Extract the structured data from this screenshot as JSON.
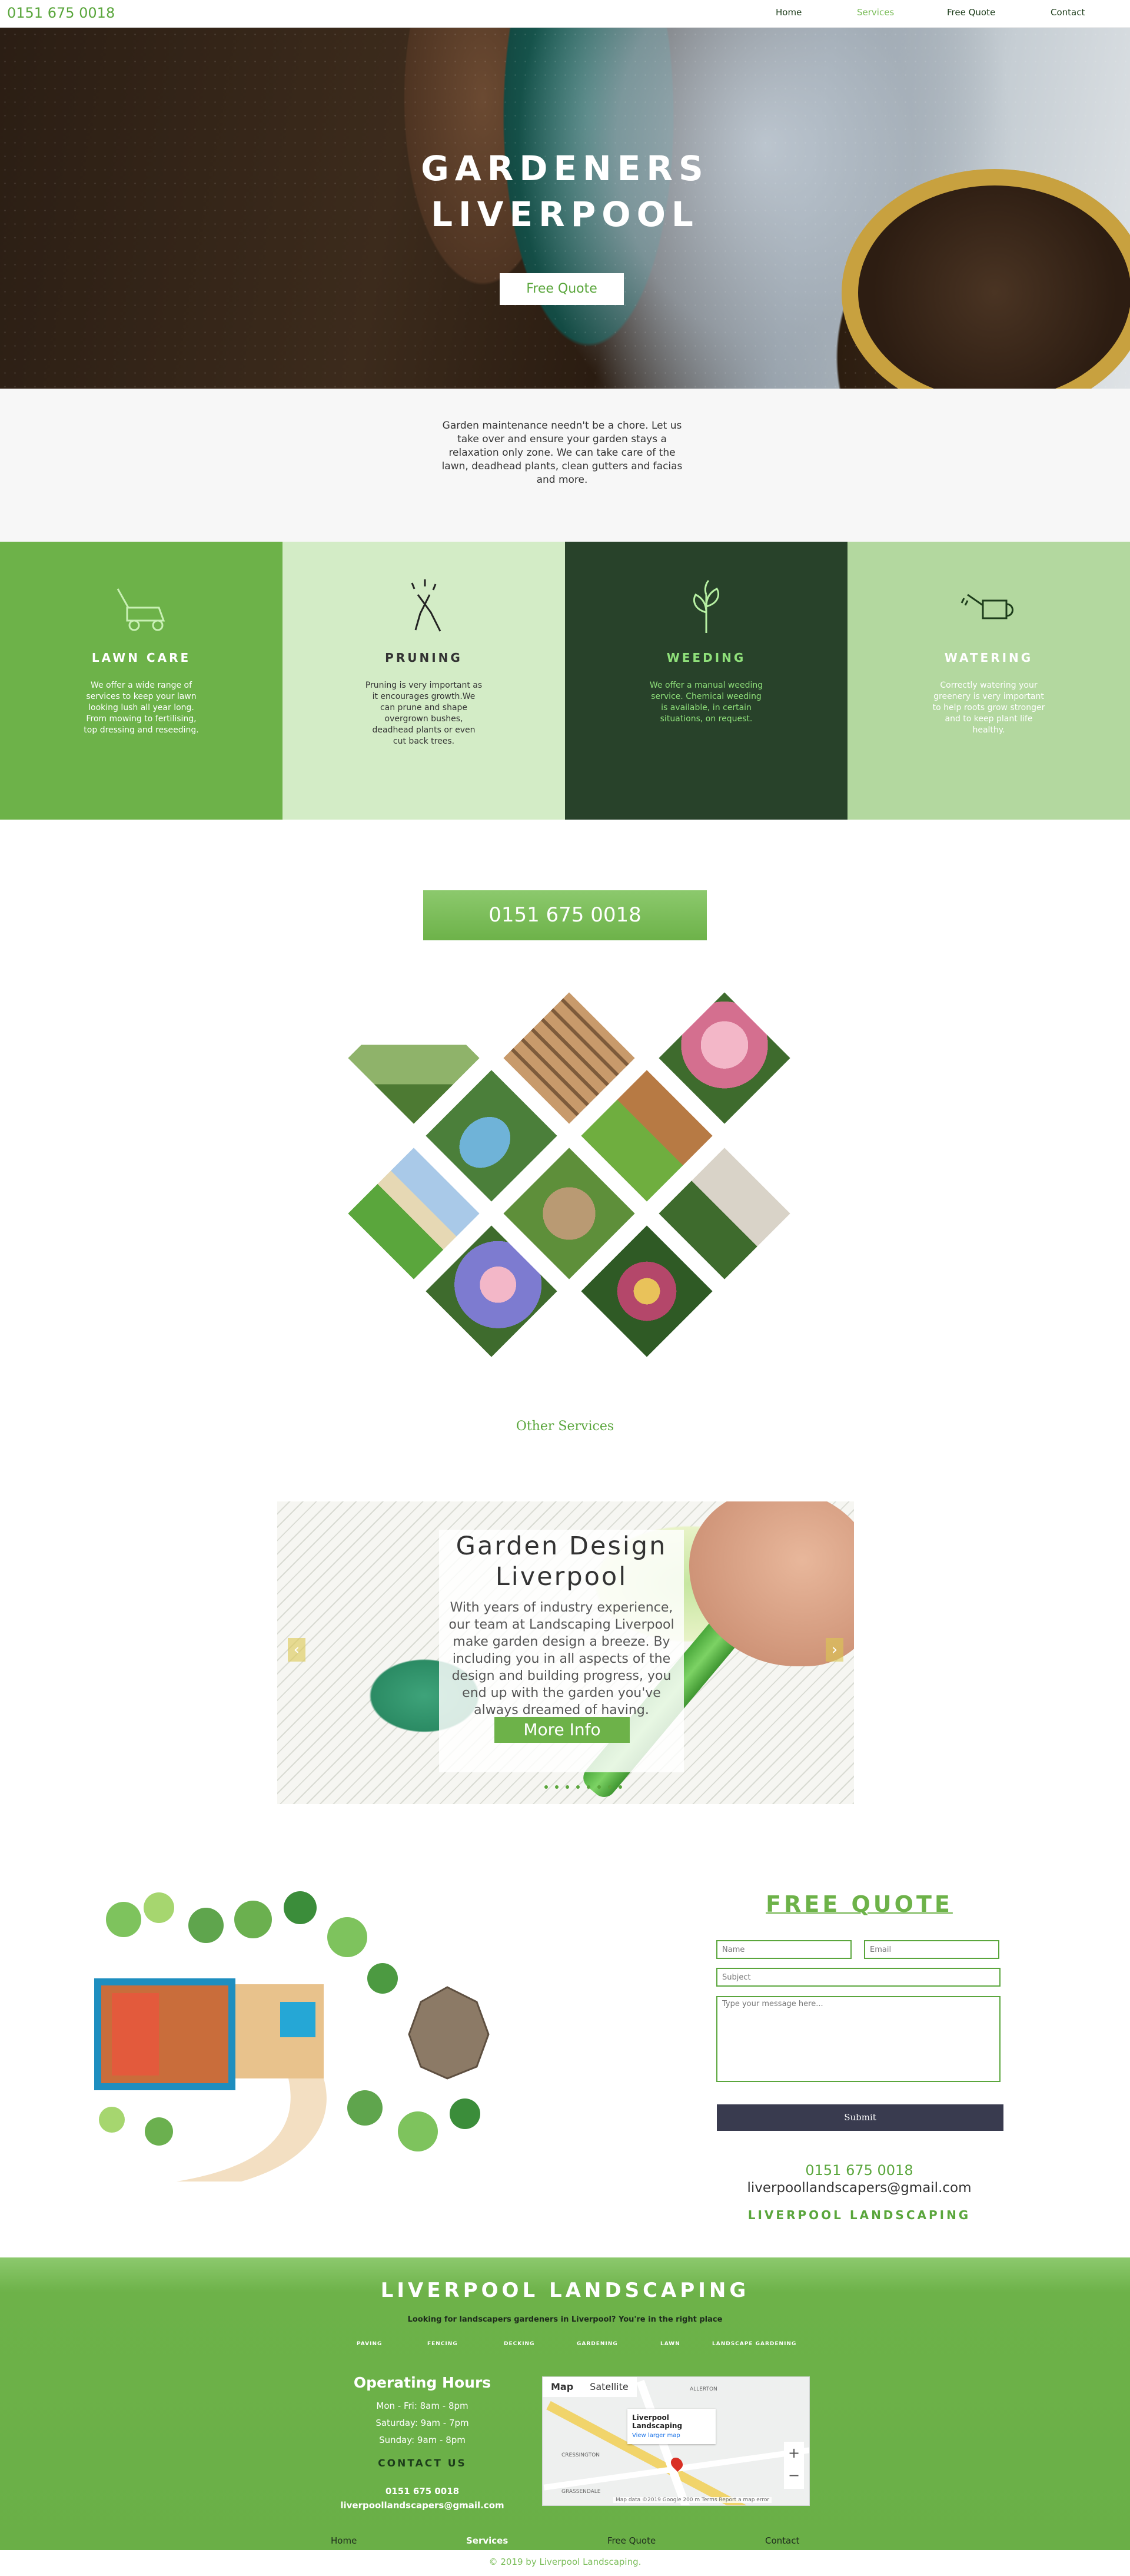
{
  "topnav": {
    "phone": "0151 675 0018",
    "items": [
      {
        "label": "Home"
      },
      {
        "label": "Services"
      },
      {
        "label": "Free Quote"
      },
      {
        "label": "Contact"
      }
    ],
    "active": "Services"
  },
  "hero": {
    "title_line1": "GARDENERS",
    "title_line2": "LIVERPOOL",
    "cta": "Free Quote"
  },
  "intro": {
    "text": "Garden maintenance needn't be a chore. Let us take over and ensure your garden stays a relaxation only zone. We can take care of the lawn, deadhead plants, clean gutters and facias and more."
  },
  "services": [
    {
      "title": "LAWN CARE",
      "text": "We offer a wide range of services to keep your lawn looking lush all year long. From mowing to fertilising, top dressing and reseeding.",
      "icon": "lawn-mower-icon",
      "bg": "#6db249",
      "fg": "#ffffff"
    },
    {
      "title": "PRUNING",
      "text": "Pruning is very important as it encourages growth.We can prune and shape overgrown bushes, deadhead plants or even cut back trees.",
      "icon": "pruning-shears-icon",
      "bg": "#d3ecc6",
      "fg": "#333333"
    },
    {
      "title": "WEEDING",
      "text": "We offer a manual weeding service. Chemical weeding is available, in certain situations, on request.",
      "icon": "plant-sprout-icon",
      "bg": "#28422a",
      "fg": "#8fe07a"
    },
    {
      "title": "WATERING",
      "text": "Correctly watering your greenery is very important to help roots grow stronger and to keep plant life healthy.",
      "icon": "watering-can-icon",
      "bg": "#b3d89f",
      "fg": "#ffffff"
    }
  ],
  "phone_band": "0151 675 0018",
  "other_services": "Other Services",
  "slider": {
    "title": "Garden Design Liverpool",
    "text": "With years of industry experience, our team at Landscaping Liverpool make garden design a breeze. By including you in all aspects of the design and building progress, you end up with the garden you've always dreamed of having.",
    "button": "More Info",
    "prev": "‹",
    "next": "›"
  },
  "quote": {
    "title": "FREE QUOTE",
    "name_placeholder": "Name",
    "email_placeholder": "Email",
    "subject_placeholder": "Subject",
    "message_placeholder": "Type your message here...",
    "submit": "Submit",
    "phone": "0151 675 0018",
    "email": "liverpoollandscapers@gmail.com",
    "brand": "LIVERPOOL LANDSCAPING"
  },
  "footer": {
    "brand": "LIVERPOOL LANDSCAPING",
    "tagline": "Looking for landscapers gardeners in Liverpool? You're in the right place",
    "categories": [
      "PAVING",
      "FENCING",
      "DECKING",
      "GARDENING",
      "LAWN",
      "LANDSCAPE GARDENING"
    ],
    "hours_title": "Operating Hours",
    "hours": [
      "Mon - Fri: 8am - 8pm",
      "Saturday: 9am - 7pm",
      "Sunday: 9am - 8pm"
    ],
    "contact_title": "CONTACT US",
    "phone": "0151 675 0018",
    "email": "liverpoollandscapers@gmail.com",
    "map": {
      "tab_map": "Map",
      "tab_satellite": "Satellite",
      "card_title": "Liverpool Landscaping",
      "card_link": "View larger map",
      "label_allerton": "ALLERTON",
      "label_cressington": "CRESSINGTON",
      "label_grassendale": "GRASSENDALE",
      "attribution": "Map data ©2019 Google   200 m   Terms   Report a map error"
    },
    "nav": [
      {
        "label": "Home"
      },
      {
        "label": "Services"
      },
      {
        "label": "Free Quote"
      },
      {
        "label": "Contact"
      }
    ]
  },
  "copyright": "© 2019 by Liverpool Landscaping."
}
